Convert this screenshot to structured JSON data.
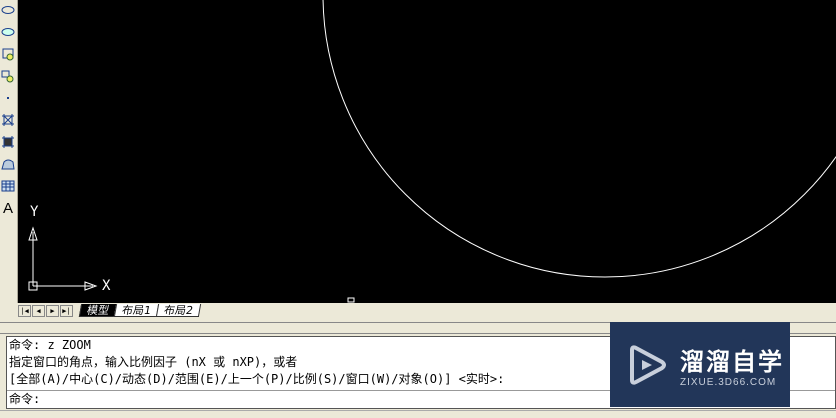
{
  "toolbar": {
    "items": [
      "ellipse-icon",
      "ellipse-arc-icon",
      "insert-block-icon",
      "make-block-icon",
      "point-icon",
      "hatch-icon",
      "gradient-icon",
      "region-icon",
      "table-icon",
      "multiline-text-icon"
    ],
    "text_label": "A"
  },
  "canvas": {
    "ucs_y": "Y",
    "ucs_x": "X"
  },
  "tabs": {
    "items": [
      "模型",
      "布局1",
      "布局2"
    ],
    "active": "模型"
  },
  "command": {
    "lines": [
      "命令: z ZOOM",
      "指定窗口的角点，输入比例因子 (nX 或 nXP)，或者",
      "[全部(A)/中心(C)/动态(D)/范围(E)/上一个(P)/比例(S)/窗口(W)/对象(O)] <实时>:"
    ],
    "prompt": "命令:"
  },
  "watermark": {
    "title": "溜溜自学",
    "url": "ZIXUE.3D66.COM"
  }
}
